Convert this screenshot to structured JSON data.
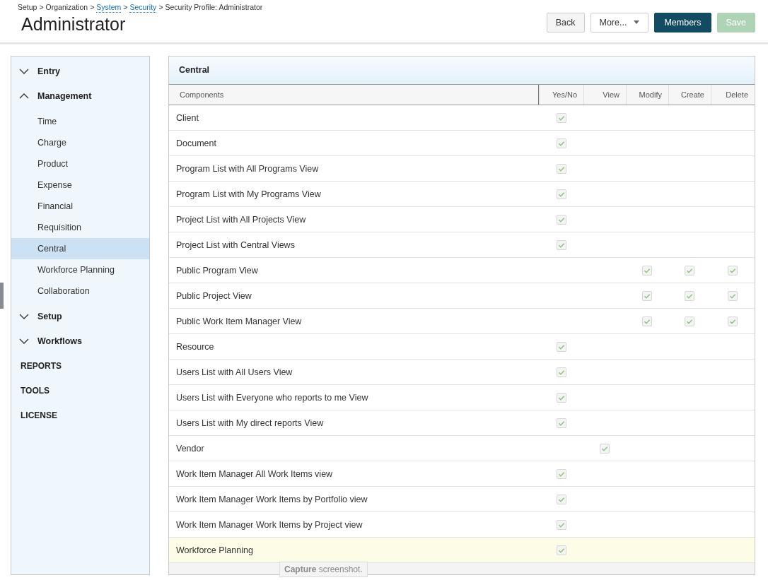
{
  "breadcrumb": [
    {
      "label": "Setup",
      "link": false
    },
    {
      "label": "Organization",
      "link": false
    },
    {
      "label": "System",
      "link": true
    },
    {
      "label": "Security",
      "link": true
    },
    {
      "label": "Security Profile: Administrator",
      "link": false
    }
  ],
  "breadcrumb_separator": ">",
  "title": "Administrator",
  "buttons": [
    {
      "label": "Back",
      "kind": "default",
      "disabled": false
    },
    {
      "label": "More...",
      "kind": "dropdown",
      "disabled": false
    },
    {
      "label": "Members",
      "kind": "primary",
      "disabled": false
    },
    {
      "label": "Save",
      "kind": "success",
      "disabled": true
    }
  ],
  "sidebar": [
    {
      "label": "Entry",
      "kind": "group",
      "expanded": false
    },
    {
      "label": "Management",
      "kind": "group",
      "expanded": true,
      "children": [
        {
          "label": "Time",
          "selected": false
        },
        {
          "label": "Charge",
          "selected": false
        },
        {
          "label": "Product",
          "selected": false
        },
        {
          "label": "Expense",
          "selected": false
        },
        {
          "label": "Financial",
          "selected": false
        },
        {
          "label": "Requisition",
          "selected": false
        },
        {
          "label": "Central",
          "selected": true
        },
        {
          "label": "Workforce Planning",
          "selected": false
        },
        {
          "label": "Collaboration",
          "selected": false
        }
      ]
    },
    {
      "label": "Setup",
      "kind": "group",
      "expanded": false
    },
    {
      "label": "Workflows",
      "kind": "group",
      "expanded": false
    },
    {
      "label": "REPORTS",
      "kind": "section"
    },
    {
      "label": "TOOLS",
      "kind": "section"
    },
    {
      "label": "LICENSE",
      "kind": "section"
    }
  ],
  "panel": {
    "title": "Central",
    "columns": [
      "Components",
      "Yes/No",
      "View",
      "Modify",
      "Create",
      "Delete"
    ],
    "rows": [
      {
        "name": "Client",
        "checked": [
          true,
          false,
          false,
          false,
          false
        ],
        "hovered": false
      },
      {
        "name": "Document",
        "checked": [
          true,
          false,
          false,
          false,
          false
        ],
        "hovered": false
      },
      {
        "name": "Program List with All Programs View",
        "checked": [
          true,
          false,
          false,
          false,
          false
        ],
        "hovered": false
      },
      {
        "name": "Program List with My Programs View",
        "checked": [
          true,
          false,
          false,
          false,
          false
        ],
        "hovered": false
      },
      {
        "name": "Project List with All Projects View",
        "checked": [
          true,
          false,
          false,
          false,
          false
        ],
        "hovered": false
      },
      {
        "name": "Project List with Central Views",
        "checked": [
          true,
          false,
          false,
          false,
          false
        ],
        "hovered": false
      },
      {
        "name": "Public Program View",
        "checked": [
          false,
          false,
          true,
          true,
          true
        ],
        "hovered": false
      },
      {
        "name": "Public Project View",
        "checked": [
          false,
          false,
          true,
          true,
          true
        ],
        "hovered": false
      },
      {
        "name": "Public Work Item Manager View",
        "checked": [
          false,
          false,
          true,
          true,
          true
        ],
        "hovered": false
      },
      {
        "name": "Resource",
        "checked": [
          true,
          false,
          false,
          false,
          false
        ],
        "hovered": false
      },
      {
        "name": "Users List with All Users View",
        "checked": [
          true,
          false,
          false,
          false,
          false
        ],
        "hovered": false
      },
      {
        "name": "Users List with Everyone who reports to me View",
        "checked": [
          true,
          false,
          false,
          false,
          false
        ],
        "hovered": false
      },
      {
        "name": "Users List with My direct reports View",
        "checked": [
          true,
          false,
          false,
          false,
          false
        ],
        "hovered": false
      },
      {
        "name": "Vendor",
        "checked": [
          false,
          true,
          false,
          false,
          false
        ],
        "hovered": false
      },
      {
        "name": "Work Item Manager All Work Items view",
        "checked": [
          true,
          false,
          false,
          false,
          false
        ],
        "hovered": false
      },
      {
        "name": "Work Item Manager Work Items by Portfolio view",
        "checked": [
          true,
          false,
          false,
          false,
          false
        ],
        "hovered": false
      },
      {
        "name": "Work Item Manager Work Items by Project view",
        "checked": [
          true,
          false,
          false,
          false,
          false
        ],
        "hovered": false
      },
      {
        "name": "Workforce Planning",
        "checked": [
          true,
          false,
          false,
          false,
          false
        ],
        "hovered": true
      }
    ]
  },
  "tooltip": "**Capture** screenshot."
}
